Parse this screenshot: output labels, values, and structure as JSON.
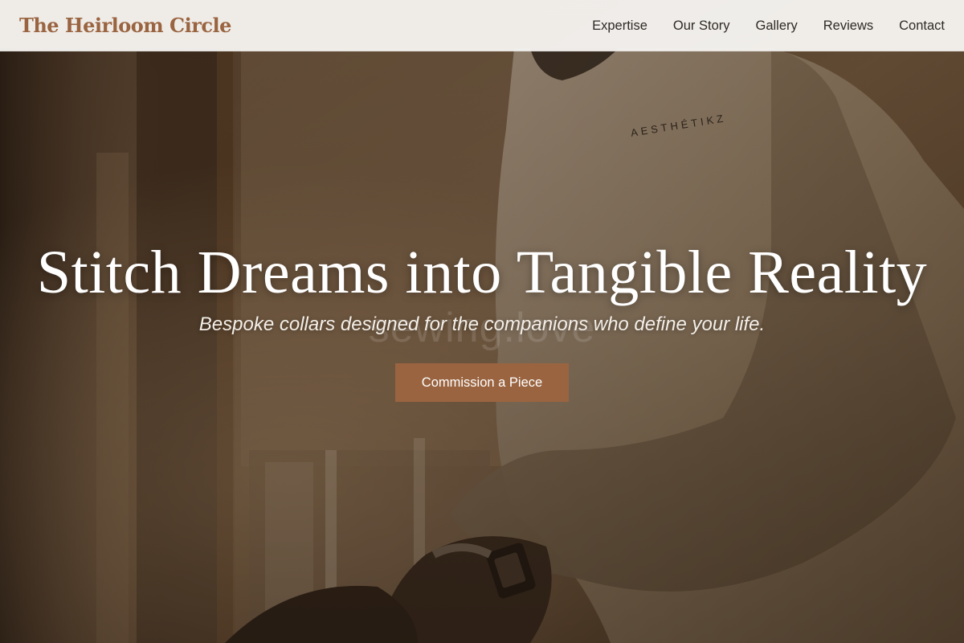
{
  "header": {
    "brand": "The Heirloom Circle",
    "nav": [
      {
        "label": "Expertise"
      },
      {
        "label": "Our Story"
      },
      {
        "label": "Gallery"
      },
      {
        "label": "Reviews"
      },
      {
        "label": "Contact"
      }
    ]
  },
  "hero": {
    "title": "Stitch Dreams into Tangible Reality",
    "subtitle": "Bespoke collars designed for the companions who define your life.",
    "cta_label": "Commission a Piece",
    "watermark": "sewing.love",
    "sweatshirt_print": "AESTHÉTIKZ"
  },
  "colors": {
    "brand": "#9a6440",
    "header_bg": "#f6f4f0",
    "nav_text": "#2e2a26",
    "hero_text": "#ffffff"
  }
}
